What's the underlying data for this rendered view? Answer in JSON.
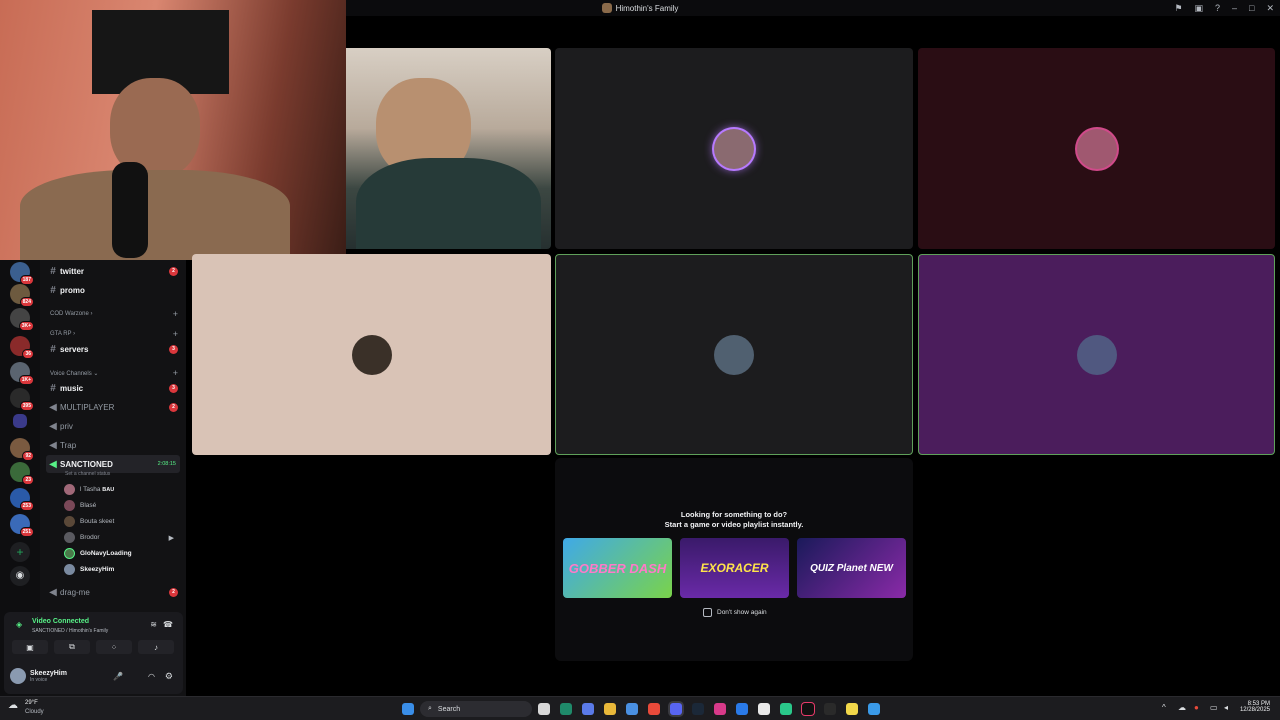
{
  "window": {
    "title": "Himothin's Family"
  },
  "sidebar": {
    "text_channels": [
      {
        "name": "twitter",
        "badge": "2"
      },
      {
        "name": "promo",
        "badge": ""
      }
    ],
    "categories": [
      {
        "label": "COD Warzone"
      },
      {
        "label": "GTA RP"
      },
      {
        "label": "Voice Channels"
      }
    ],
    "servers_channel": {
      "name": "servers",
      "badge": "3"
    },
    "voice_channels": [
      {
        "name": "music",
        "badge": "3"
      },
      {
        "name": "MULTIPLAYER",
        "badge": "2"
      },
      {
        "name": "priv",
        "badge": ""
      },
      {
        "name": "Trap",
        "badge": ""
      }
    ],
    "active_channel": {
      "name": "SANCTIONED",
      "timer": "2:08:15",
      "status_hint": "Set a channel status"
    },
    "voice_users": [
      {
        "name": "l Tasha",
        "tag": "BAU"
      },
      {
        "name": "Blasé"
      },
      {
        "name": "Bouta skeet"
      },
      {
        "name": "Brodor"
      },
      {
        "name": "GloNavyLoading"
      },
      {
        "name": "SkeezyHim"
      }
    ],
    "after_channel": {
      "name": "drag-me",
      "badge": "2"
    },
    "server_badges": [
      "187",
      "824",
      "3K+",
      "36",
      "1K+",
      "395",
      "92",
      "23",
      "253",
      "251"
    ]
  },
  "voice_panel": {
    "status": "Video Connected",
    "location": "SANCTIONED / Himothin's Family"
  },
  "user": {
    "name": "SkeezyHim",
    "status": "In voice"
  },
  "modal": {
    "line1": "Looking for something to do?",
    "line2": "Start a game or video playlist instantly.",
    "games": [
      "GOBBER DASH",
      "EXORACER",
      "QUIZ Planet NEW"
    ],
    "checkbox_label": "Don't show again"
  },
  "taskbar": {
    "weather_temp": "29°F",
    "weather_desc": "Cloudy",
    "search_placeholder": "Search",
    "time": "8:53 PM",
    "date": "12/28/2025"
  },
  "colors": {
    "tile_dark": "#1c1c1e",
    "tile_maroon": "#2a0d14",
    "tile_beige": "#d9c3b6",
    "tile_green_border": "#5fa05a",
    "tile_purple": "#4b1d5c",
    "accent_green": "#57f287",
    "badge_red": "#da373c"
  }
}
